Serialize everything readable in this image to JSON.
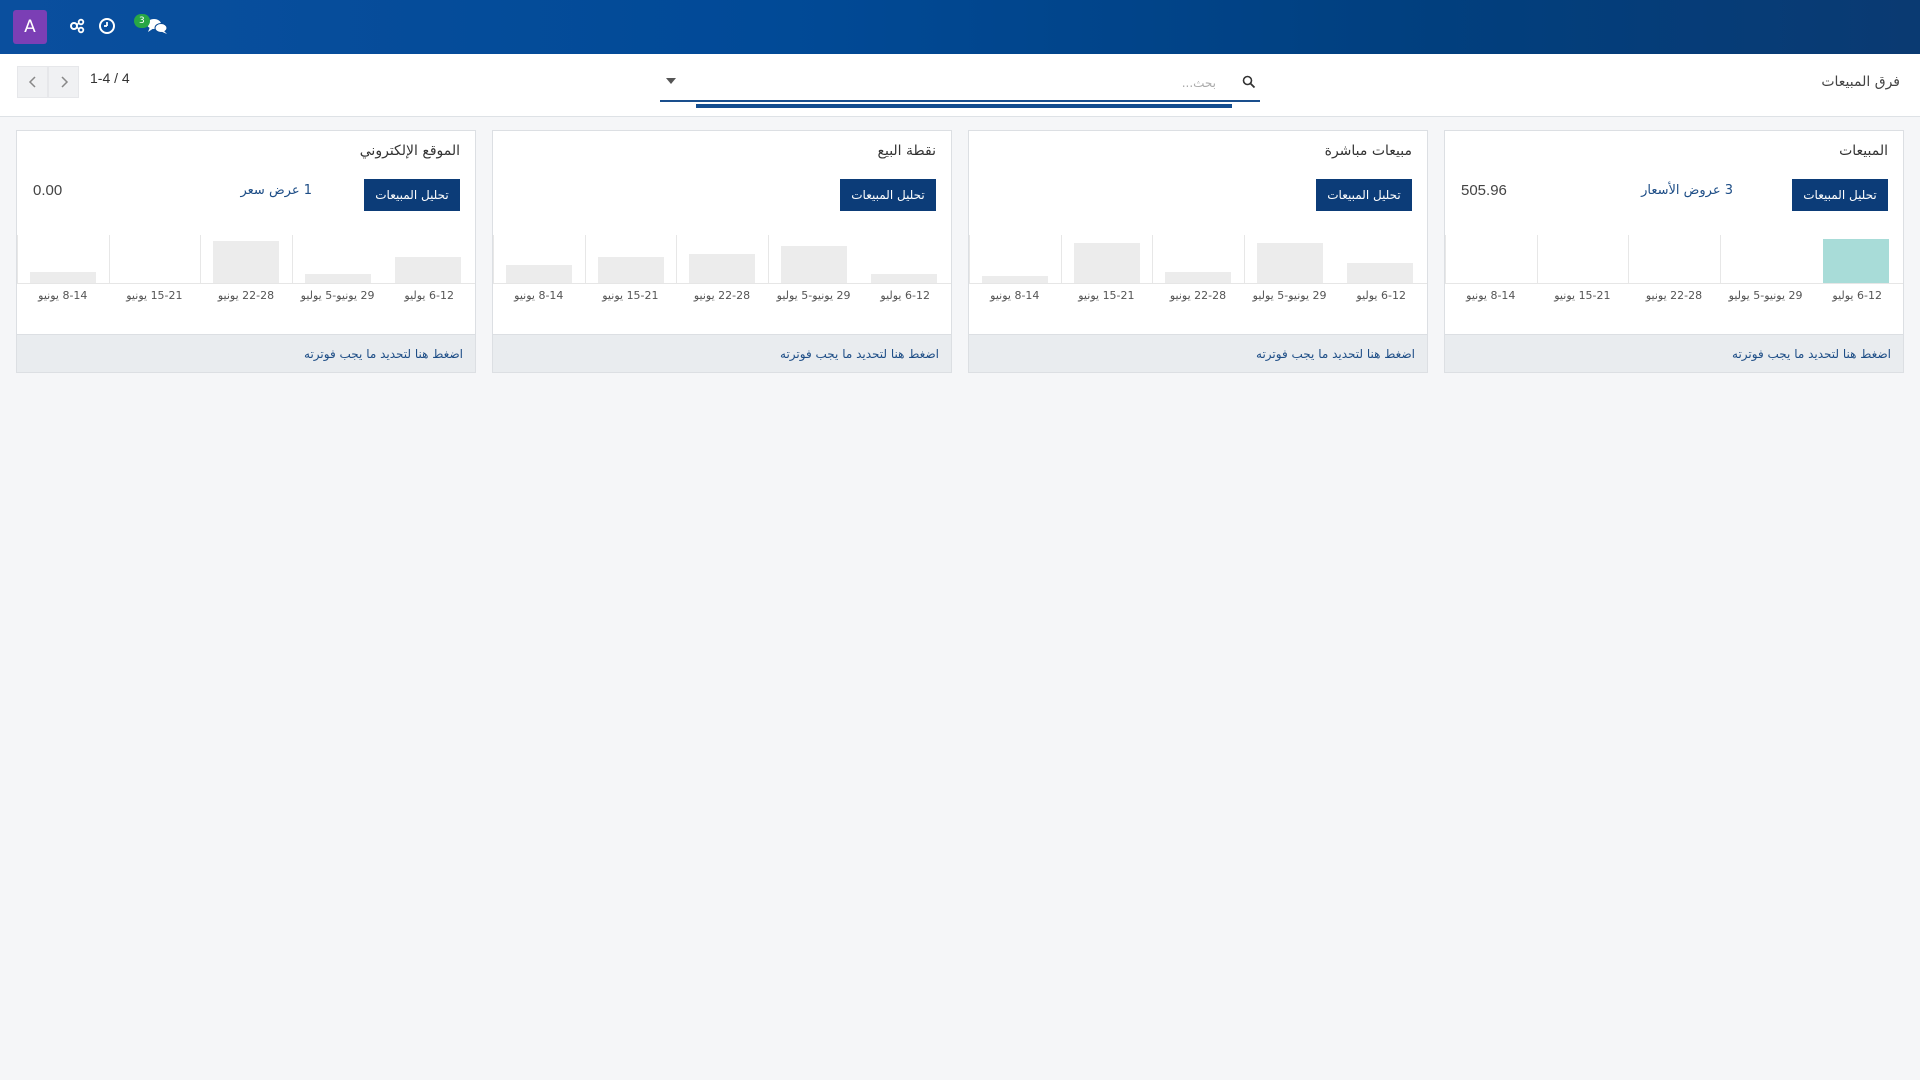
{
  "navbar": {
    "avatar_letter": "A",
    "messages_count": "3",
    "icons": [
      "activity-icon",
      "clock-icon",
      "chat-icon"
    ]
  },
  "controlbar": {
    "breadcrumb": "فرق المبيعات",
    "search_placeholder": "بحث...",
    "pager_value": "1-4 / 4"
  },
  "chart_axis": [
    "6-12 يوليو",
    "29 يونيو-5 يوليو",
    "22-28 يونيو",
    "15-21 يونيو",
    "8-14 يونيو"
  ],
  "cards": [
    {
      "title": "المبيعات",
      "button_label": "تحليل المبيعات",
      "link_text": "3 عروض الأسعار",
      "amount": "505.96",
      "footer_text": "اضغط هنا لتحديد ما يجب فوترته",
      "chart_data": {
        "type": "bar",
        "categories": [
          "6-12 يوليو",
          "29 يونيو-5 يوليو",
          "22-28 يونيو",
          "15-21 يونيو",
          "8-14 يونيو"
        ],
        "values": [
          1.0,
          0,
          0,
          0,
          0
        ],
        "active_index": 0
      }
    },
    {
      "title": "مبيعات مباشرة",
      "button_label": "تحليل المبيعات",
      "link_text": "",
      "amount": "",
      "footer_text": "اضغط هنا لتحديد ما يجب فوترته",
      "chart_data": {
        "type": "bar",
        "categories": [
          "6-12 يوليو",
          "29 يونيو-5 يوليو",
          "22-28 يونيو",
          "15-21 يونيو",
          "8-14 يونيو"
        ],
        "values": [
          0.45,
          0.9,
          0.25,
          0.9,
          0.15
        ],
        "active_index": -1
      }
    },
    {
      "title": "نقطة البيع",
      "button_label": "تحليل المبيعات",
      "link_text": "",
      "amount": "",
      "footer_text": "اضغط هنا لتحديد ما يجب فوترته",
      "chart_data": {
        "type": "bar",
        "categories": [
          "6-12 يوليو",
          "29 يونيو-5 يوليو",
          "22-28 يونيو",
          "15-21 يونيو",
          "8-14 يونيو"
        ],
        "values": [
          0.2,
          0.85,
          0.65,
          0.6,
          0.4
        ],
        "active_index": -1
      }
    },
    {
      "title": "الموقع الإلكتروني",
      "button_label": "تحليل المبيعات",
      "link_text": "1 عرض سعر",
      "amount": "0.00",
      "footer_text": "اضغط هنا لتحديد ما يجب فوترته",
      "chart_data": {
        "type": "bar",
        "categories": [
          "6-12 يوليو",
          "29 يونيو-5 يوليو",
          "22-28 يونيو",
          "15-21 يونيو",
          "8-14 يونيو"
        ],
        "values": [
          0.6,
          0.2,
          0.95,
          0,
          0.25
        ],
        "active_index": -1
      }
    }
  ]
}
